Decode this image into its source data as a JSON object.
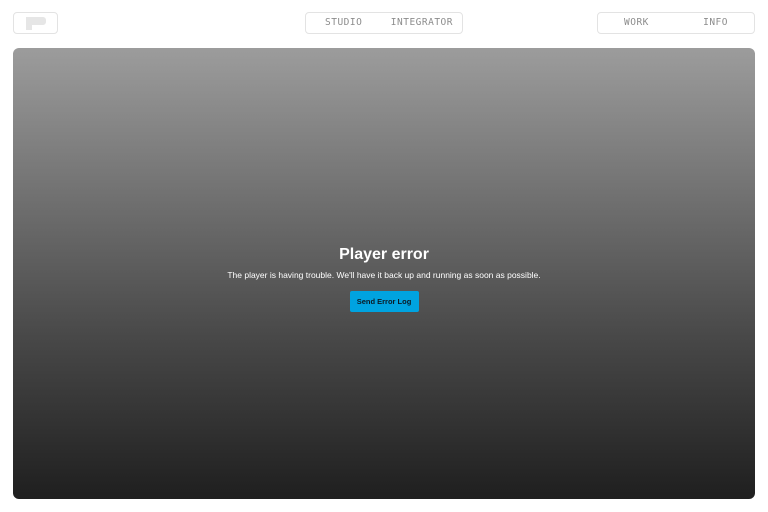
{
  "header": {
    "logo_icon": "brand-logo-icon",
    "center_nav": [
      {
        "label": "STUDIO"
      },
      {
        "label": "INTEGRATOR"
      }
    ],
    "right_nav": [
      {
        "label": "WORK"
      },
      {
        "label": "INFO"
      }
    ]
  },
  "player": {
    "error_title": "Player error",
    "error_message": "The player is having trouble. We'll have it back up and running as soon as possible.",
    "send_button_label": "Send Error Log",
    "button_color": "#00a3e0"
  }
}
